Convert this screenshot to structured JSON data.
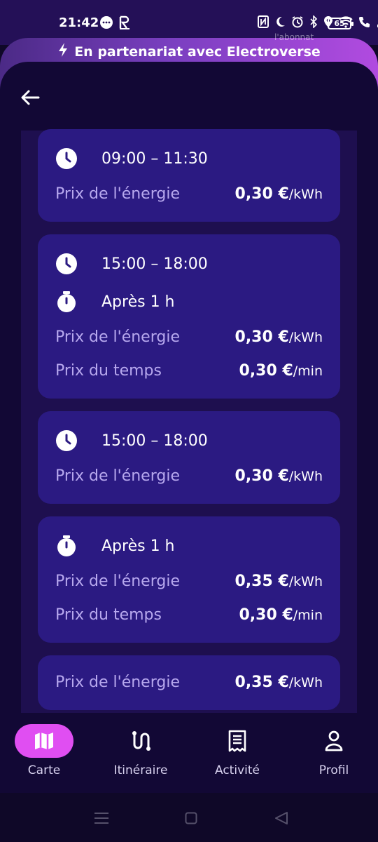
{
  "status_bar": {
    "time": "21:42",
    "icons_left": [
      "chat-bubble-icon",
      "r-app-icon"
    ],
    "icons_right": [
      "nfc-icon",
      "moon-icon",
      "alarm-icon",
      "bluetooth-icon",
      "location-icon",
      "wifi-icon",
      "wifi-call-icon",
      "signal-icon"
    ],
    "battery": "65"
  },
  "banner": {
    "text": "En partenariat avec Electroverse",
    "icon": "bolt-icon",
    "behind_text": "l'abonnat"
  },
  "header": {
    "back_icon": "arrow-left-icon"
  },
  "cards": [
    {
      "time_range": "09:00 – 11:30",
      "energy_label": "Prix de l'énergie",
      "energy_price": "0,30 €",
      "energy_unit": "/kWh"
    },
    {
      "time_range": "15:00 – 18:00",
      "after_label": "Après 1 h",
      "energy_label": "Prix de l'énergie",
      "energy_price": "0,30 €",
      "energy_unit": "/kWh",
      "time_label": "Prix du temps",
      "time_price": "0,30 €",
      "time_unit": "/min"
    },
    {
      "time_range": "15:00 – 18:00",
      "energy_label": "Prix de l'énergie",
      "energy_price": "0,30 €",
      "energy_unit": "/kWh"
    },
    {
      "after_label": "Après 1 h",
      "energy_label": "Prix de l'énergie",
      "energy_price": "0,35 €",
      "energy_unit": "/kWh",
      "time_label": "Prix du temps",
      "time_price": "0,30 €",
      "time_unit": "/min"
    },
    {
      "energy_label": "Prix de l'énergie",
      "energy_price": "0,35 €",
      "energy_unit": "/kWh"
    }
  ],
  "tabs": [
    {
      "label": "Carte",
      "icon": "map-icon",
      "active": true
    },
    {
      "label": "Itinéraire",
      "icon": "route-icon",
      "active": false
    },
    {
      "label": "Activité",
      "icon": "receipt-icon",
      "active": false
    },
    {
      "label": "Profil",
      "icon": "person-icon",
      "active": false
    }
  ],
  "colors": {
    "background": "#120835",
    "card": "#2b1a82",
    "accent": "#e04ef2",
    "label": "#b7a8ee"
  }
}
